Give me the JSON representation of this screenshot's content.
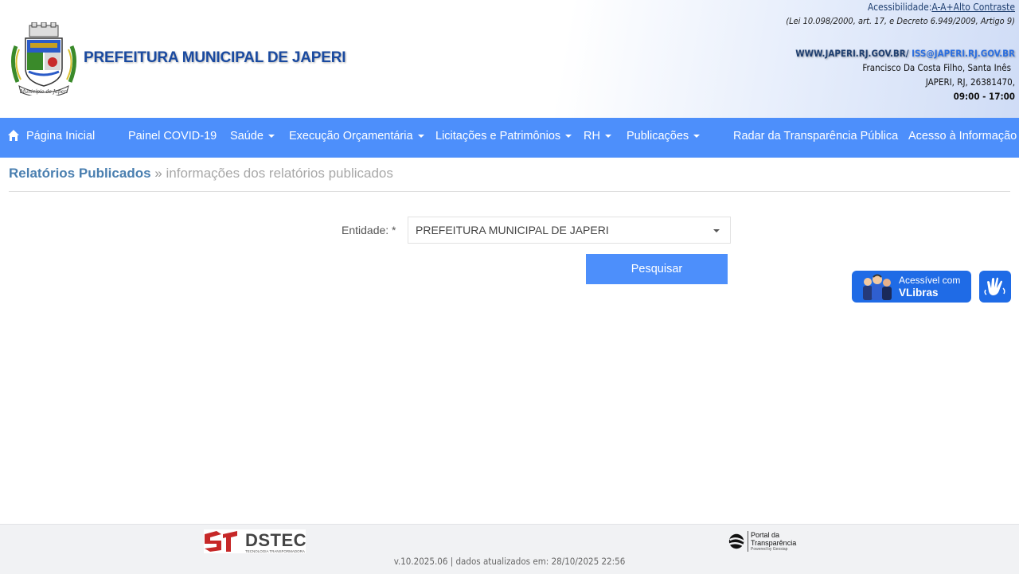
{
  "header": {
    "title": "PREFEITURA MUNICIPAL DE JAPERI",
    "crest_caption": "Município de Japeri",
    "accessibility": {
      "label": "Acessibilidade:",
      "a_minus": "A-",
      "a_plus": "A+",
      "high_contrast": "Alto Contraste"
    },
    "law_text": "(Lei 10.098/2000, art. 17, e Decreto 6.949/2009, Artigo 9)",
    "website": "WWW.JAPERI.RJ.GOV.BR/",
    "email": "ISS@JAPERI.RJ.GOV.BR",
    "address_line1": "Francisco Da Costa Filho, Santa Inês",
    "address_line2": "JAPERI, RJ, 26381470,",
    "hours": "09:00 - 17:00"
  },
  "nav": {
    "items": [
      {
        "label": "Página Inicial"
      },
      {
        "label": "Painel COVID-19"
      },
      {
        "label": "Saúde"
      },
      {
        "label": "Execução Orçamentária"
      },
      {
        "label": "Licitações e Patrimônios"
      },
      {
        "label": "RH"
      },
      {
        "label": "Publicações"
      },
      {
        "label": "Radar da Transparência Pública"
      },
      {
        "label": "Acesso à Informação"
      }
    ]
  },
  "breadcrumb": {
    "main": "Relatórios Publicados",
    "separator": "»",
    "sub": "informações dos relatórios publicados"
  },
  "form": {
    "entity_label": "Entidade: *",
    "entity_value": "PREFEITURA MUNICIPAL DE JAPERI",
    "search_button": "Pesquisar"
  },
  "vlibras": {
    "line1": "Acessível com",
    "line2": "VLibras"
  },
  "footer": {
    "dstec_name": "DSTEC",
    "dstec_tagline": "TECNOLOGIA TRANSFORMADORA",
    "portal_name_line1": "Portal da",
    "portal_name_line2": "Transparência",
    "portal_powered": "Powered by Geosiap",
    "version": "v.10.2025.06 | dados atualizados em: 28/10/2025 22:56"
  },
  "colors": {
    "nav_bg": "#4d8ffb",
    "title": "#1a4aa0",
    "breadcrumb_main": "#4a7fb0",
    "vlibras": "#1f6be6"
  }
}
